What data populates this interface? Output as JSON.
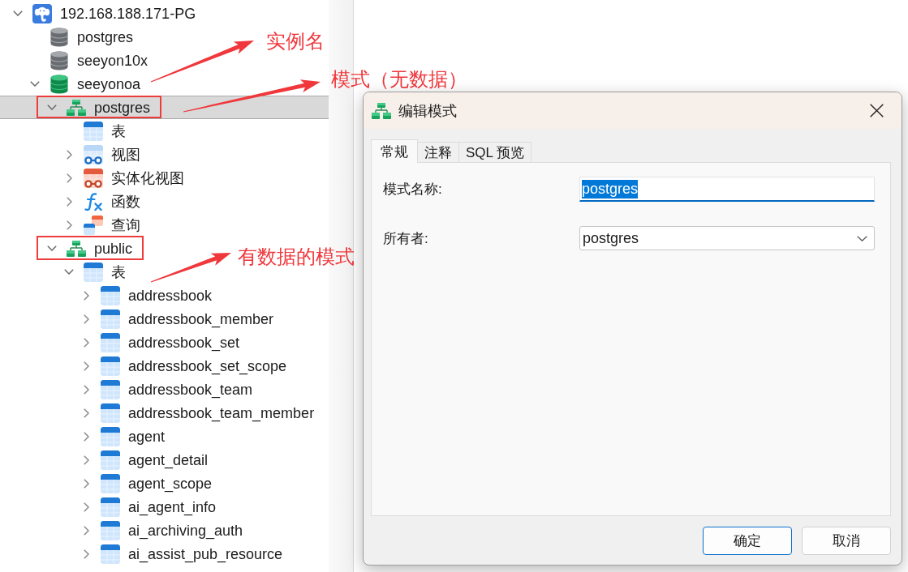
{
  "tree": [
    {
      "kind": "connection",
      "label": "192.168.188.171-PG",
      "expandable": true,
      "expanded": true,
      "selected": false,
      "boxed": false,
      "children": [
        {
          "kind": "database",
          "label": "postgres",
          "connected": false,
          "expandable": false,
          "selected": false,
          "boxed": false
        },
        {
          "kind": "database",
          "label": "seeyon10x",
          "connected": false,
          "expandable": false,
          "selected": false,
          "boxed": false
        },
        {
          "kind": "database",
          "label": "seeyonoa",
          "connected": true,
          "expandable": true,
          "expanded": true,
          "selected": false,
          "boxed": false,
          "children": [
            {
              "kind": "schema",
              "label": "postgres",
              "expandable": true,
              "expanded": true,
              "selected": true,
              "boxed": true,
              "children": [
                {
                  "kind": "tables",
                  "label": "表",
                  "expandable": false,
                  "selected": false,
                  "boxed": false
                },
                {
                  "kind": "views",
                  "label": "视图",
                  "expandable": true,
                  "expanded": false,
                  "selected": false,
                  "boxed": false
                },
                {
                  "kind": "matviews",
                  "label": "实体化视图",
                  "expandable": true,
                  "expanded": false,
                  "selected": false,
                  "boxed": false
                },
                {
                  "kind": "functions",
                  "label": "函数",
                  "expandable": true,
                  "expanded": false,
                  "selected": false,
                  "boxed": false
                },
                {
                  "kind": "queries",
                  "label": "查询",
                  "expandable": true,
                  "expanded": false,
                  "selected": false,
                  "boxed": false
                }
              ]
            },
            {
              "kind": "schema",
              "label": "public",
              "expandable": true,
              "expanded": true,
              "selected": false,
              "boxed": true,
              "children": [
                {
                  "kind": "tables",
                  "label": "表",
                  "expandable": true,
                  "expanded": true,
                  "selected": false,
                  "boxed": false,
                  "children": [
                    {
                      "kind": "table",
                      "label": "addressbook",
                      "expandable": true,
                      "expanded": false,
                      "selected": false,
                      "boxed": false
                    },
                    {
                      "kind": "table",
                      "label": "addressbook_member",
                      "expandable": true,
                      "expanded": false,
                      "selected": false,
                      "boxed": false
                    },
                    {
                      "kind": "table",
                      "label": "addressbook_set",
                      "expandable": true,
                      "expanded": false,
                      "selected": false,
                      "boxed": false
                    },
                    {
                      "kind": "table",
                      "label": "addressbook_set_scope",
                      "expandable": true,
                      "expanded": false,
                      "selected": false,
                      "boxed": false
                    },
                    {
                      "kind": "table",
                      "label": "addressbook_team",
                      "expandable": true,
                      "expanded": false,
                      "selected": false,
                      "boxed": false
                    },
                    {
                      "kind": "table",
                      "label": "addressbook_team_member",
                      "expandable": true,
                      "expanded": false,
                      "selected": false,
                      "boxed": false
                    },
                    {
                      "kind": "table",
                      "label": "agent",
                      "expandable": true,
                      "expanded": false,
                      "selected": false,
                      "boxed": false
                    },
                    {
                      "kind": "table",
                      "label": "agent_detail",
                      "expandable": true,
                      "expanded": false,
                      "selected": false,
                      "boxed": false
                    },
                    {
                      "kind": "table",
                      "label": "agent_scope",
                      "expandable": true,
                      "expanded": false,
                      "selected": false,
                      "boxed": false
                    },
                    {
                      "kind": "table",
                      "label": "ai_agent_info",
                      "expandable": true,
                      "expanded": false,
                      "selected": false,
                      "boxed": false
                    },
                    {
                      "kind": "table",
                      "label": "ai_archiving_auth",
                      "expandable": true,
                      "expanded": false,
                      "selected": false,
                      "boxed": false
                    },
                    {
                      "kind": "table",
                      "label": "ai_assist_pub_resource",
                      "expandable": true,
                      "expanded": false,
                      "selected": false,
                      "boxed": false
                    }
                  ]
                }
              ]
            }
          ]
        }
      ]
    }
  ],
  "annotations": [
    {
      "text": "实例名"
    },
    {
      "text": "模式（无数据）"
    },
    {
      "text": "有数据的模式"
    }
  ],
  "dialog": {
    "title": "编辑模式",
    "tabs": [
      {
        "label": "常规",
        "selected": true
      },
      {
        "label": "注释",
        "selected": false
      },
      {
        "label": "SQL 预览",
        "selected": false
      }
    ],
    "fields": [
      {
        "kind": "text",
        "label": "模式名称:",
        "value": "postgres",
        "focused": true
      },
      {
        "kind": "select",
        "label": "所有者:",
        "value": "postgres",
        "focused": false
      }
    ],
    "buttons": [
      {
        "label": "确定",
        "default": true
      },
      {
        "label": "取消",
        "default": false
      }
    ]
  }
}
